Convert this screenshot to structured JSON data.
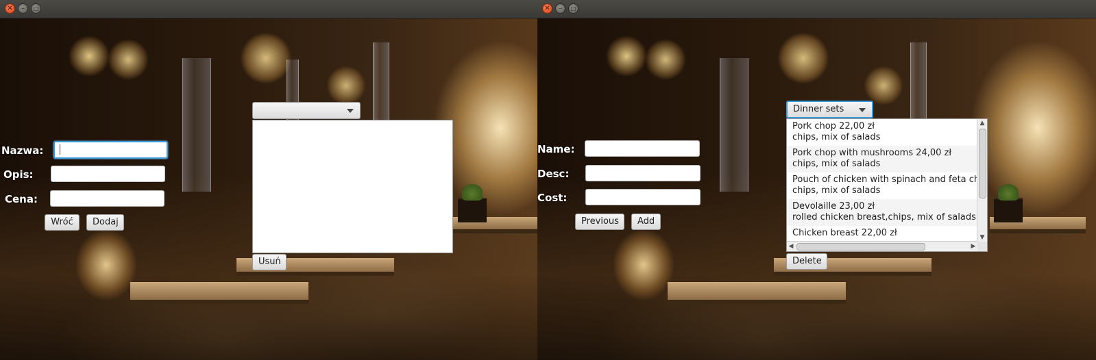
{
  "left_window": {
    "form": {
      "name_label": "Nazwa:",
      "desc_label": "Opis:",
      "cost_label": "Cena:",
      "name_value": "",
      "desc_value": "",
      "cost_value": "",
      "back_button": "Wróć",
      "add_button": "Dodaj"
    },
    "menu": {
      "category_selected": "",
      "delete_button": "Usuń",
      "items": []
    }
  },
  "right_window": {
    "form": {
      "name_label": "Name:",
      "desc_label": "Desc:",
      "cost_label": "Cost:",
      "name_value": "",
      "desc_value": "",
      "cost_value": "",
      "back_button": "Previous",
      "add_button": "Add"
    },
    "menu": {
      "category_selected": "Dinner sets",
      "delete_button": "Delete",
      "items": [
        {
          "line1": "Pork chop           22,00 zł",
          "line2": "chips, mix of salads"
        },
        {
          "line1": "Pork chop with mushrooms 24,00 zł",
          "line2": "chips, mix of salads"
        },
        {
          "line1": "Pouch of chicken with spinach and feta ch",
          "line2": "chips, mix of salads"
        },
        {
          "line1": "Devolaille           23,00 zł",
          "line2": "rolled chicken breast,chips, mix of salads"
        },
        {
          "line1": "Chicken breast       22,00 zł",
          "line2": ""
        }
      ]
    }
  },
  "icons": {
    "close": "✕",
    "minimize": "–",
    "maximize": "□",
    "scroll_up": "▲",
    "scroll_down": "▼",
    "scroll_left": "◀",
    "scroll_right": "▶"
  },
  "colors": {
    "focus_ring": "#3a9ad9",
    "close_button": "#e8572a"
  }
}
